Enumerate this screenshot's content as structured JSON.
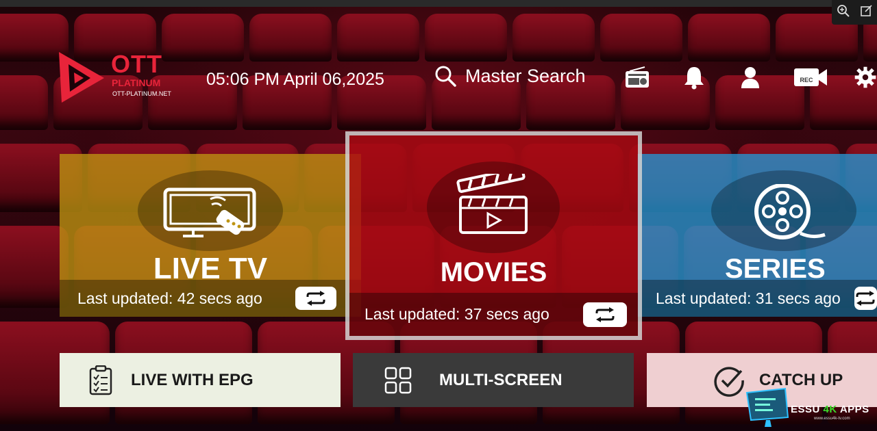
{
  "logo": {
    "word": "OTT",
    "sub": "PLATINUM",
    "url": "OTT-PLATINUM.NET"
  },
  "header": {
    "time": "05:06 PM",
    "date": "April 06,2025",
    "search_label": "Master Search",
    "icons": [
      "radio-icon",
      "bell-icon",
      "user-location-icon",
      "rec-camera-icon",
      "settings-gear-icon"
    ],
    "rec_text": "REC"
  },
  "tiles": {
    "live": {
      "label": "LIVE TV",
      "updated": "Last updated: 42 secs ago",
      "color": "#be9412"
    },
    "movies": {
      "label": "MOVIES",
      "updated": "Last updated: 37 secs ago",
      "color": "#aa0a12"
    },
    "series": {
      "label": "SERIES",
      "updated": "Last updated: 31 secs ago",
      "color": "#2696d2"
    }
  },
  "buttons": {
    "epg": "LIVE WITH EPG",
    "multi": "MULTI-SCREEN",
    "catchup": "CATCH UP"
  },
  "watermark": {
    "brand_a": "ESSU",
    "brand_b": "4K",
    "brand_c": "APPS",
    "url": "www.essu4k-tv.com"
  }
}
